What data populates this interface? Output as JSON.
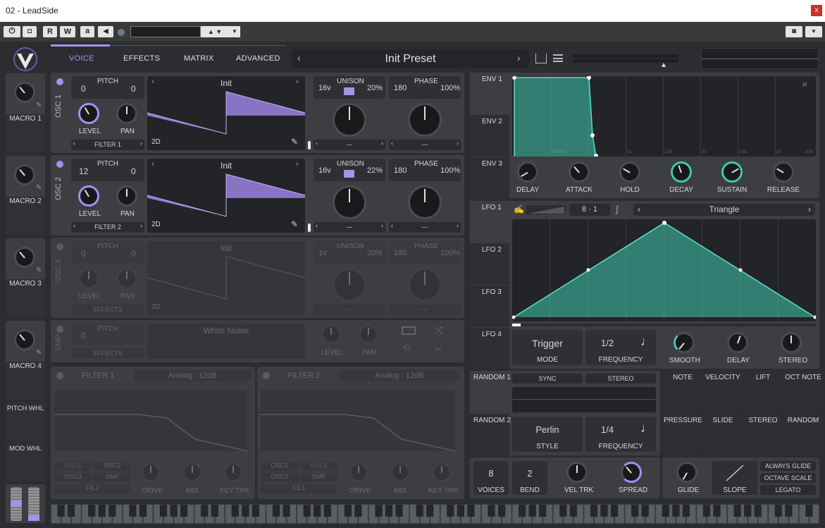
{
  "window": {
    "title": "02 - LeadSide",
    "close": "x"
  },
  "toolbar": {
    "r": "R",
    "w": "W",
    "a": "a"
  },
  "nav": {
    "tabs": [
      "VOICE",
      "EFFECTS",
      "MATRIX",
      "ADVANCED"
    ],
    "active": "VOICE"
  },
  "preset": {
    "name": "Init Preset"
  },
  "macros": [
    "MACRO 1",
    "MACRO 2",
    "MACRO 3",
    "MACRO 4"
  ],
  "wheels": {
    "pitch": "PITCH WHL",
    "mod": "MOD WHL"
  },
  "osc1": {
    "name": "OSC 1",
    "pitch_label": "PITCH",
    "transpose": "0",
    "tune": "0",
    "level": "LEVEL",
    "pan": "PAN",
    "dest": "FILTER 1",
    "wave": "Init",
    "dim": "2D",
    "unison_label": "UNISON",
    "voices": "16v",
    "detune": "20%",
    "phase_label": "PHASE",
    "phase": "180",
    "phase_rand": "100%",
    "sel1": "---",
    "sel2": "---"
  },
  "osc2": {
    "name": "OSC 2",
    "pitch_label": "PITCH",
    "transpose": "12",
    "tune": "0",
    "level": "LEVEL",
    "pan": "PAN",
    "dest": "FILTER 2",
    "wave": "Init",
    "dim": "2D",
    "unison_label": "UNISON",
    "voices": "16v",
    "detune": "22%",
    "phase_label": "PHASE",
    "phase": "180",
    "phase_rand": "100%",
    "sel1": "---",
    "sel2": "---"
  },
  "osc3": {
    "name": "OSC 3",
    "pitch_label": "PITCH",
    "transpose": "0",
    "tune": "0",
    "level": "LEVEL",
    "pan": "PAN",
    "dest": "EFFECTS",
    "wave": "Init",
    "dim": "2D",
    "unison_label": "UNISON",
    "voices": "1v",
    "detune": "20%",
    "phase_label": "PHASE",
    "phase": "180",
    "phase_rand": "100%",
    "sel1": "---",
    "sel2": "---"
  },
  "smp": {
    "name": "SMP",
    "pitch_label": "PITCH",
    "transpose": "0",
    "dest": "EFFECTS",
    "sample": "White Noise",
    "level": "LEVEL",
    "pan": "PAN"
  },
  "filter1": {
    "name": "FILTER 1",
    "type": "Analog : 12dB",
    "src": [
      "OSC1",
      "OSC2",
      "OSC3",
      "SMP",
      "FIL2"
    ],
    "drive": "DRIVE",
    "mix": "MIX",
    "keytrk": "KEY TRK"
  },
  "filter2": {
    "name": "FILTER 2",
    "type": "Analog : 12dB",
    "src": [
      "OSC1",
      "OSC2",
      "OSC3",
      "SMP",
      "FIL1"
    ],
    "drive": "DRIVE",
    "mix": "MIX",
    "keytrk": "KEY TRK"
  },
  "env": {
    "tabs": [
      "ENV 1",
      "ENV 2",
      "ENV 3"
    ],
    "knobs": [
      "DELAY",
      "ATTACK",
      "HOLD",
      "DECAY",
      "SUSTAIN",
      "RELEASE"
    ],
    "ticks": [
      "500ms",
      "1s",
      "1.5s",
      "2s",
      "2.5s",
      "3s",
      "3.5s"
    ]
  },
  "lfo": {
    "tabs": [
      "LFO 1",
      "LFO 2",
      "LFO 3",
      "LFO 4"
    ],
    "grid_a": "8",
    "grid_b": "1",
    "shape": "Triangle",
    "mode_value": "Trigger",
    "mode": "MODE",
    "freq_value": "1/2",
    "freq": "FREQUENCY",
    "smooth": "SMOOTH",
    "delay": "DELAY",
    "stereo": "STEREO"
  },
  "random": {
    "tabs": [
      "RANDOM 1",
      "RANDOM 2"
    ],
    "sync": "SYNC",
    "stereo": "STEREO",
    "style_value": "Perlin",
    "style": "STYLE",
    "freq_value": "1/4",
    "freq": "FREQUENCY"
  },
  "mod_sources": [
    "NOTE",
    "VELOCITY",
    "LIFT",
    "OCT NOTE",
    "PRESSURE",
    "SLIDE",
    "STEREO",
    "RANDOM"
  ],
  "voice": {
    "voices_value": "8",
    "voices": "VOICES",
    "bend_value": "2",
    "bend": "BEND",
    "veltrk": "VEL TRK",
    "spread": "SPREAD"
  },
  "glide": {
    "glide": "GLIDE",
    "slope": "SLOPE",
    "always": "ALWAYS GLIDE",
    "octave": "OCTAVE SCALE",
    "legato": "LEGATO"
  },
  "colors": {
    "accent": "#a98ff0",
    "teal": "#3fc8b0",
    "bg": "#2b2d30",
    "panel": "#3c3e41"
  }
}
